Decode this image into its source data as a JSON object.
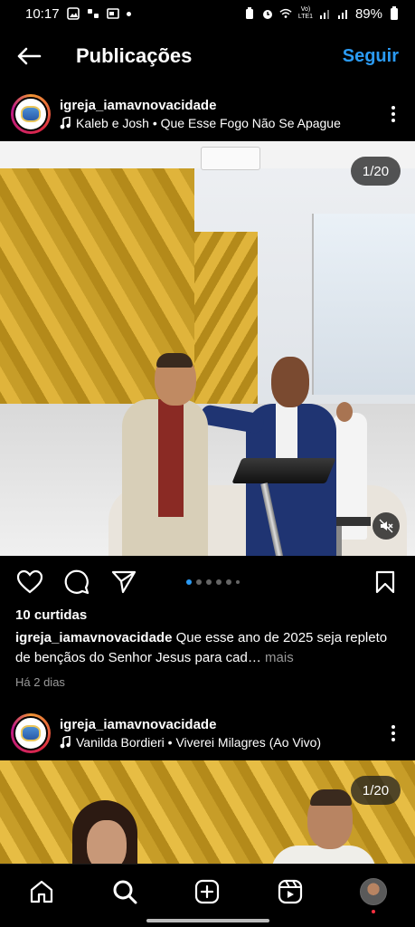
{
  "status_bar": {
    "time": "10:17",
    "network": "Vo) LTE1",
    "battery": "89%"
  },
  "header": {
    "title": "Publicações",
    "follow_label": "Seguir"
  },
  "posts": [
    {
      "username": "igreja_iamavnovacidade",
      "music": "Kaleb e Josh • Que Esse Fogo Não Se Apague",
      "counter": "1/20",
      "likes": "10 curtidas",
      "caption_user": "igreja_iamavnovacidade",
      "caption_text": " Que esse ano de 2025 seja repleto de bençãos do Senhor Jesus para cad…",
      "caption_more": " mais",
      "date": "Há 2 dias"
    },
    {
      "username": "igreja_iamavnovacidade",
      "music": "Vanilda Bordieri • Viverei Milagres (Ao Vivo)",
      "counter": "1/20"
    }
  ],
  "colors": {
    "accent": "#2b9bf4",
    "background": "#000000",
    "notification": "#ff3040"
  },
  "icons": {
    "back": "arrow-left-icon",
    "like": "heart-icon",
    "comment": "comment-icon",
    "share": "send-icon",
    "save": "bookmark-icon",
    "mute": "speaker-muted-icon",
    "music": "music-note-icon",
    "more": "vertical-dots-icon",
    "nav": [
      "home-icon",
      "search-icon",
      "create-icon",
      "reels-icon",
      "profile-avatar"
    ]
  }
}
